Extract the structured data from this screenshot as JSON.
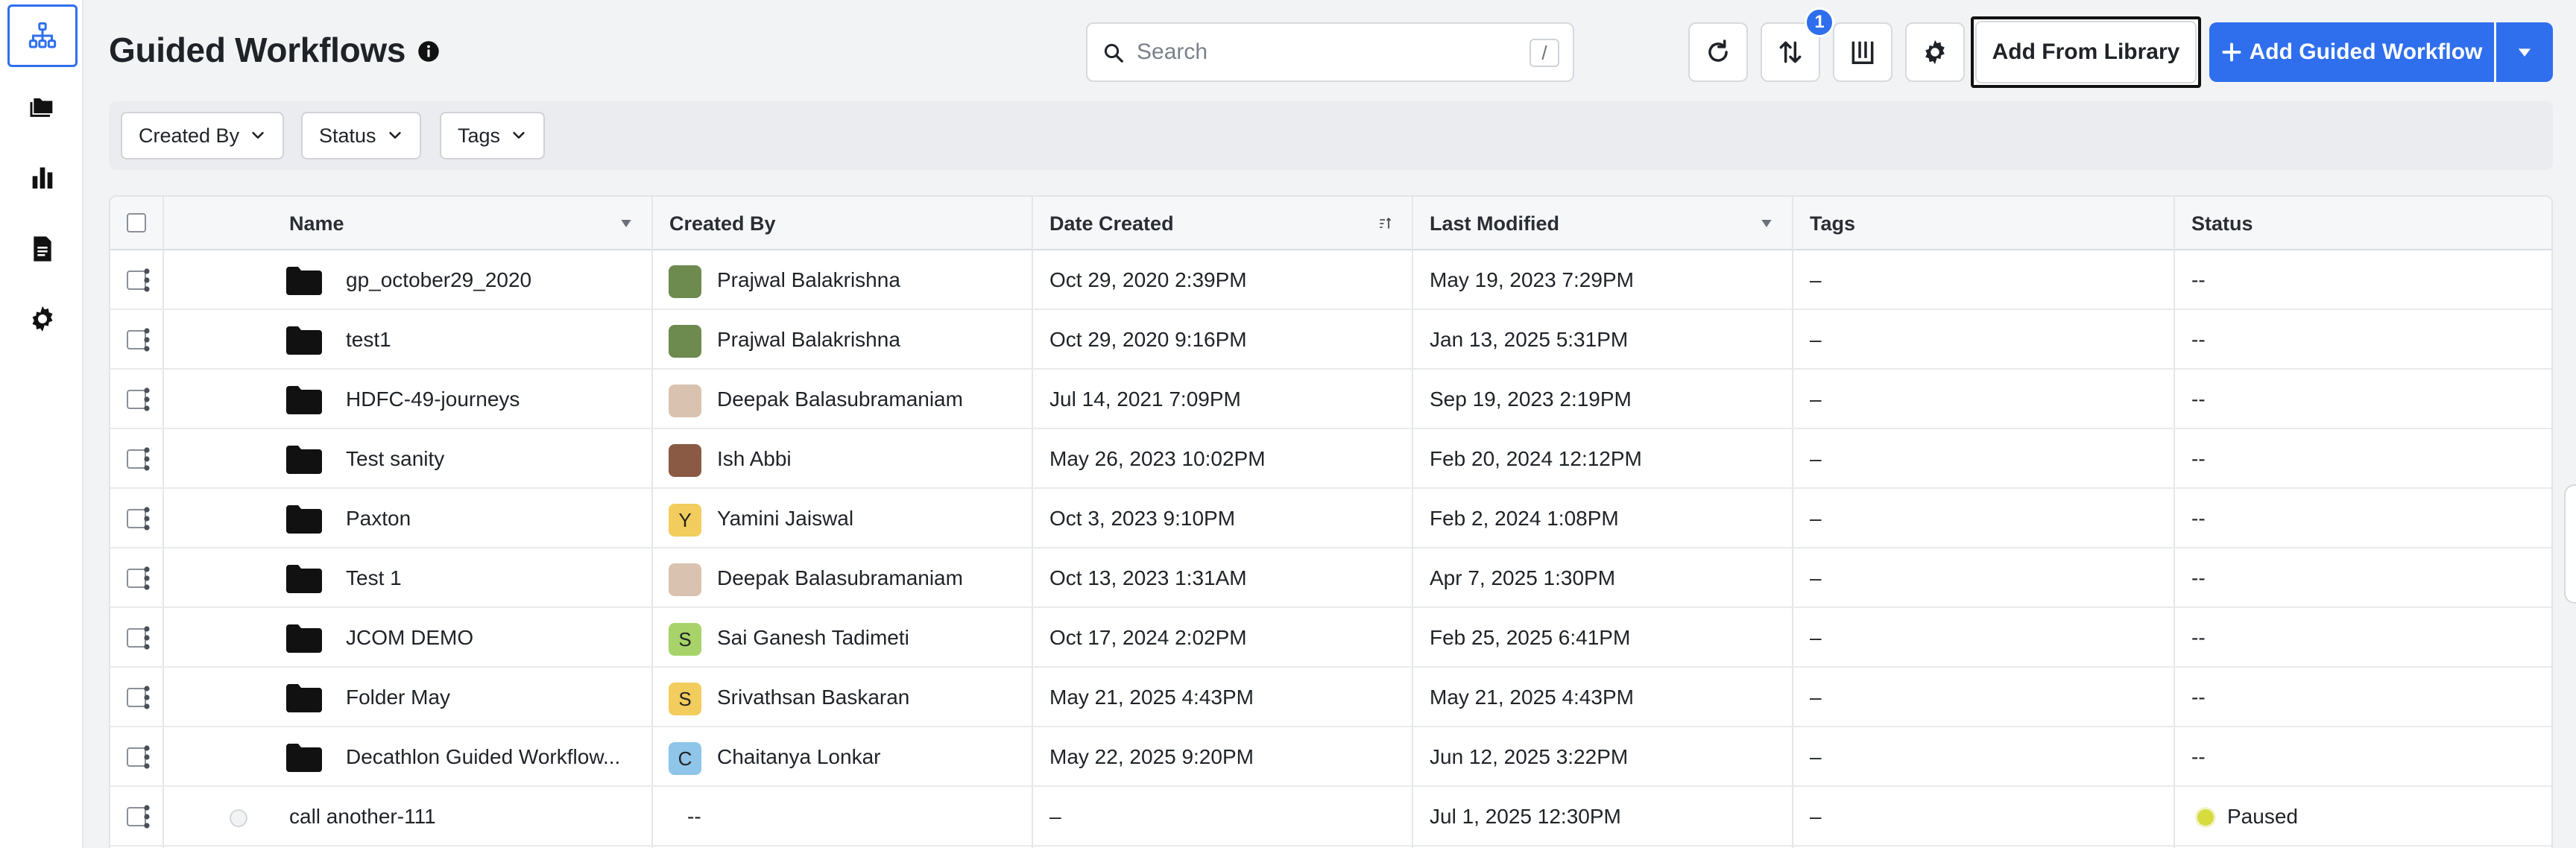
{
  "page": {
    "title": "Guided Workflows",
    "search_placeholder": "Search",
    "search_shortcut": "/",
    "sort_badge": "1",
    "add_from_library": "Add From Library",
    "add_guided_workflow": "Add Guided Workflow"
  },
  "sidebar": {
    "items": [
      {
        "icon": "workflow-tree-icon",
        "active": true
      },
      {
        "icon": "folders-icon",
        "active": false
      },
      {
        "icon": "bar-chart-icon",
        "active": false
      },
      {
        "icon": "document-icon",
        "active": false
      },
      {
        "icon": "gear-icon",
        "active": false
      }
    ]
  },
  "filters": {
    "created_by": "Created By",
    "status": "Status",
    "tags": "Tags"
  },
  "table": {
    "headers": {
      "name": "Name",
      "created_by": "Created By",
      "date_created": "Date Created",
      "last_modified": "Last Modified",
      "tags": "Tags",
      "status": "Status"
    },
    "rows": [
      {
        "name": "gp_october29_2020",
        "created_by": "Prajwal Balakrishna",
        "avatar": "",
        "avatar_color": "#6d8a4f",
        "date_created": "Oct 29, 2020 2:39PM",
        "last_modified": "May 19, 2023 7:29PM",
        "tags": "–",
        "status": "--"
      },
      {
        "name": "test1",
        "created_by": "Prajwal Balakrishna",
        "avatar": "",
        "avatar_color": "#6d8a4f",
        "date_created": "Oct 29, 2020 9:16PM",
        "last_modified": "Jan 13, 2025 5:31PM",
        "tags": "–",
        "status": "--"
      },
      {
        "name": "HDFC-49-journeys",
        "created_by": "Deepak Balasubramaniam",
        "avatar": "",
        "avatar_color": "#d9c2b0",
        "date_created": "Jul 14, 2021 7:09PM",
        "last_modified": "Sep 19, 2023 2:19PM",
        "tags": "–",
        "status": "--"
      },
      {
        "name": "Test sanity",
        "created_by": "Ish Abbi",
        "avatar": "",
        "avatar_color": "#8a5a44",
        "date_created": "May 26, 2023 10:02PM",
        "last_modified": "Feb 20, 2024 12:12PM",
        "tags": "–",
        "status": "--"
      },
      {
        "name": "Paxton",
        "created_by": "Yamini Jaiswal",
        "avatar": "Y",
        "avatar_color": "#f2cc5c",
        "date_created": "Oct 3, 2023 9:10PM",
        "last_modified": "Feb 2, 2024 1:08PM",
        "tags": "–",
        "status": "--"
      },
      {
        "name": "Test 1",
        "created_by": "Deepak Balasubramaniam",
        "avatar": "",
        "avatar_color": "#d9c2b0",
        "date_created": "Oct 13, 2023 1:31AM",
        "last_modified": "Apr 7, 2025 1:30PM",
        "tags": "–",
        "status": "--"
      },
      {
        "name": "JCOM DEMO",
        "created_by": "Sai Ganesh Tadimeti",
        "avatar": "S",
        "avatar_color": "#a7d36a",
        "date_created": "Oct 17, 2024 2:02PM",
        "last_modified": "Feb 25, 2025 6:41PM",
        "tags": "–",
        "status": "--"
      },
      {
        "name": "Folder May",
        "created_by": "Srivathsan Baskaran",
        "avatar": "S",
        "avatar_color": "#f2cc5c",
        "date_created": "May 21, 2025 4:43PM",
        "last_modified": "May 21, 2025 4:43PM",
        "tags": "–",
        "status": "--"
      },
      {
        "name": "Decathlon Guided Workflow...",
        "created_by": "Chaitanya Lonkar",
        "avatar": "C",
        "avatar_color": "#8ec5e8",
        "date_created": "May 22, 2025 9:20PM",
        "last_modified": "Jun 12, 2025 3:22PM",
        "tags": "–",
        "status": "--"
      },
      {
        "name": "call another-111",
        "created_by": "--",
        "avatar": null,
        "avatar_color": null,
        "date_created": "–",
        "last_modified": "Jul 1, 2025 12:30PM",
        "tags": "–",
        "status": "Paused",
        "status_color": "#d6dc3e"
      }
    ]
  }
}
